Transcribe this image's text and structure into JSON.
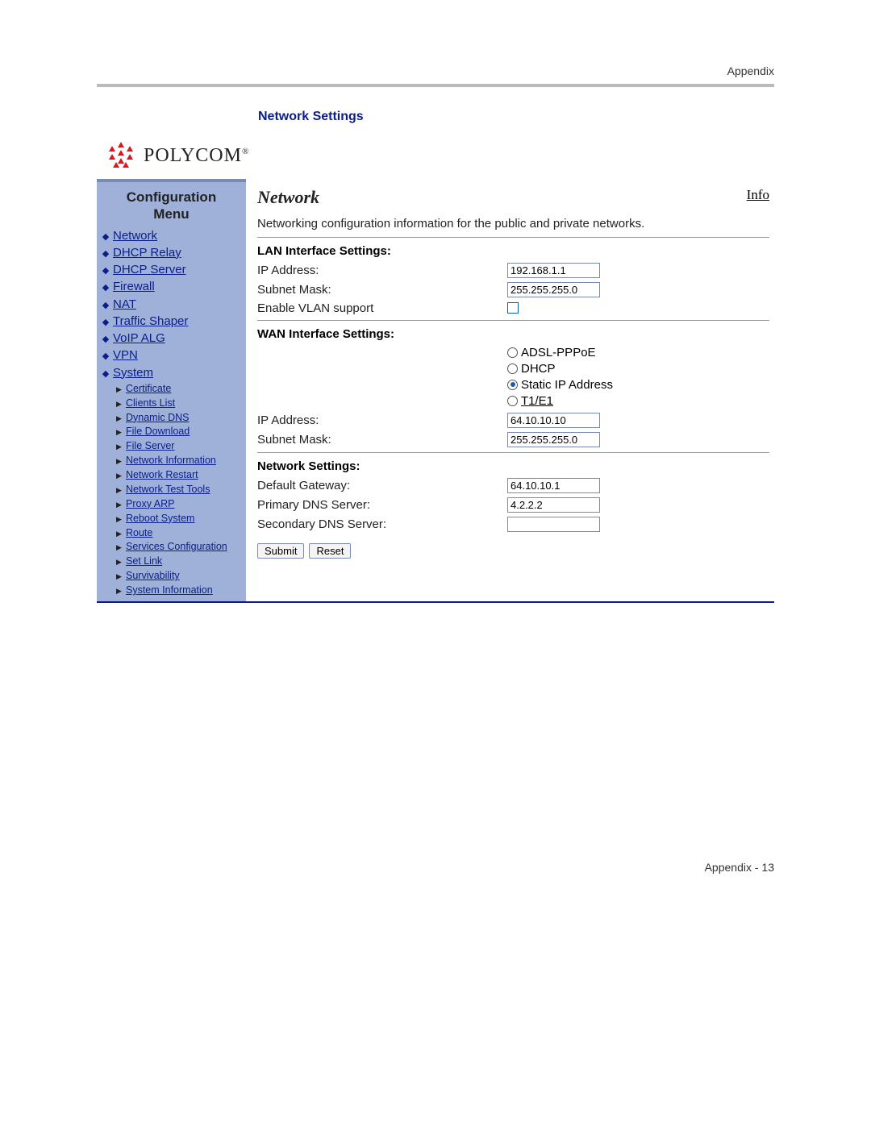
{
  "doc": {
    "header": "Appendix",
    "section_title": "Network Settings",
    "footer": "Appendix - 13"
  },
  "brand": {
    "name": "POLYCOM",
    "reg": "®"
  },
  "sidebar": {
    "title_line1": "Configuration",
    "title_line2": "Menu",
    "primary": [
      "Network",
      "DHCP Relay",
      "DHCP Server",
      "Firewall",
      "NAT",
      "Traffic Shaper",
      "VoIP ALG",
      "VPN",
      "System"
    ],
    "sub": [
      "Certificate",
      "Clients List",
      "Dynamic DNS",
      "File Download",
      "File Server",
      "Network Information",
      "Network Restart",
      "Network Test Tools",
      "Proxy ARP",
      "Reboot System",
      "Route",
      "Services Configuration",
      "Set Link",
      "Survivability",
      "System Information"
    ]
  },
  "content": {
    "title": "Network",
    "info_link": "Info",
    "description": "Networking configuration information for the public and private networks."
  },
  "lan": {
    "heading": "LAN Interface Settings:",
    "ip_label": "IP Address:",
    "ip_value": "192.168.1.1",
    "mask_label": "Subnet Mask:",
    "mask_value": "255.255.255.0",
    "vlan_label": "Enable VLAN support",
    "vlan_checked": false
  },
  "wan": {
    "heading": "WAN Interface Settings:",
    "options": [
      {
        "label": "ADSL-PPPoE",
        "selected": false,
        "link": false
      },
      {
        "label": "DHCP",
        "selected": false,
        "link": false
      },
      {
        "label": "Static IP Address",
        "selected": true,
        "link": false
      },
      {
        "label": "T1/E1",
        "selected": false,
        "link": true
      }
    ],
    "ip_label": "IP Address:",
    "ip_value": "64.10.10.10",
    "mask_label": "Subnet Mask:",
    "mask_value": "255.255.255.0"
  },
  "net": {
    "heading": "Network Settings:",
    "gw_label": "Default Gateway:",
    "gw_value": "64.10.10.1",
    "dns1_label": "Primary DNS Server:",
    "dns1_value": "4.2.2.2",
    "dns2_label": "Secondary DNS Server:",
    "dns2_value": ""
  },
  "buttons": {
    "submit": "Submit",
    "reset": "Reset"
  }
}
